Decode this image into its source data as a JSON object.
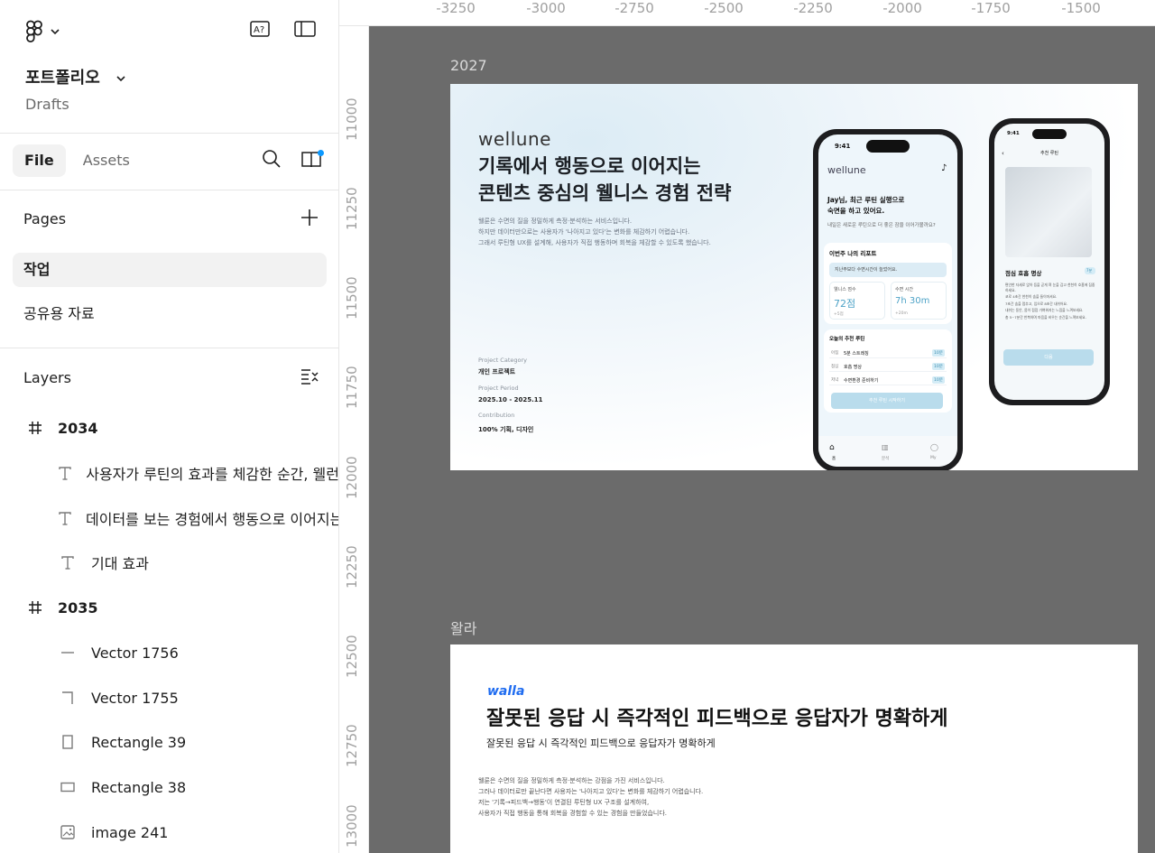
{
  "header": {
    "project_name": "포트폴리오",
    "project_location": "Drafts"
  },
  "tabs": {
    "file": "File",
    "assets": "Assets"
  },
  "pages": {
    "title": "Pages",
    "items": [
      "작업",
      "공유용 자료"
    ]
  },
  "layers": {
    "title": "Layers",
    "items": [
      {
        "kind": "frame",
        "icon": "frame-icon",
        "label": "2034"
      },
      {
        "kind": "text",
        "icon": "text-icon",
        "label": "사용자가 루틴의 효과를 체감한 순간, 웰런"
      },
      {
        "kind": "text",
        "icon": "text-icon",
        "label": "데이터를 보는 경험에서 행동으로 이어지는"
      },
      {
        "kind": "text",
        "icon": "text-icon",
        "label": "기대 효과"
      },
      {
        "kind": "frame",
        "icon": "frame-icon",
        "label": "2035"
      },
      {
        "kind": "vector",
        "icon": "line-icon",
        "label": "Vector 1756"
      },
      {
        "kind": "vector",
        "icon": "corner-icon",
        "label": "Vector 1755"
      },
      {
        "kind": "rect",
        "icon": "rectangle-portrait-icon",
        "label": "Rectangle 39"
      },
      {
        "kind": "rect",
        "icon": "rectangle-landscape-icon",
        "label": "Rectangle 38"
      },
      {
        "kind": "image",
        "icon": "image-icon",
        "label": "image 241"
      }
    ]
  },
  "ruler": {
    "top": [
      "-3250",
      "-3000",
      "-2750",
      "-2500",
      "-2250",
      "-2000",
      "-1750",
      "-1500"
    ],
    "left": [
      "11000",
      "11250",
      "11500",
      "11750",
      "12000",
      "12250",
      "12500",
      "12750",
      "13000"
    ]
  },
  "canvas": {
    "frame1": {
      "label": "2027",
      "brand": "wellune",
      "headline1": "기록에서 행동으로 이어지는",
      "headline2": "콘텐츠 중심의 웰니스 경험 전략",
      "desc1": "웰룬은 수면의 질을 정밀하게 측정·분석하는 서비스입니다.",
      "desc2": "하지만 데이터만으로는 사용자가 '나아지고 있다'는 변화를 체감하기 어렵습니다.",
      "desc3": "그래서 루틴형 UX를 설계해, 사용자가 직접 행동하며 회복을 체감할 수 있도록 했습니다.",
      "meta_category_label": "Project Category",
      "meta_category": "개인 프로젝트",
      "meta_period_label": "Project Period",
      "meta_period": "2025.10 - 2025.11",
      "meta_contrib_label": "Contribution",
      "meta_contrib": "100% 기획, 디자인",
      "phone1": {
        "time": "9:41",
        "brand": "wellune",
        "greeting1": "Jay님, 최근 루틴 실행으로",
        "greeting2": "숙면을 하고 있어요.",
        "question": "내일은 새로운 루틴으로 더 좋은 잠을 이어가볼까요?",
        "report_title": "이번주 나의 리포트",
        "report_note": "지난주보다 수면시간이 늘었어요.",
        "score_label": "웰니스 점수",
        "score_value": "72점",
        "score_delta": "+5점",
        "sleep_label": "수면 시간",
        "sleep_value": "7h 30m",
        "sleep_delta": "+20m",
        "routine_title": "오늘의 추천 루틴",
        "routines": [
          {
            "tag": "아침",
            "name": "5분 스트레칭",
            "time": "10분"
          },
          {
            "tag": "점심",
            "name": "호흡 명상",
            "time": "10분"
          },
          {
            "tag": "저녁",
            "name": "수면환경 준비하기",
            "time": "10분"
          }
        ],
        "cta": "추천 루틴 시작하기",
        "nav": [
          "홈",
          "분석",
          "My"
        ]
      },
      "phone2": {
        "time": "9:41",
        "title": "추천 루틴",
        "routine_name": "점심 호흡 명상",
        "badge": "7분",
        "bullets": [
          "편안한 자세로 앉아 등을 곧게 펴 눈을 감고 천천히 호흡에 집중하세요.",
          "코로 4초간 천천히 숨을 들이마셔요.",
          "7초간 숨을 멈추고, 입으로 8초간 내쉬어요.",
          "내쉬는 동안, 몸이 점점 가벼워지는 느낌을 느껴보세요.",
          "총 5~7분간 반복하며 마음을 비우는 순간을 느껴보세요."
        ],
        "cta": "다음"
      }
    },
    "frame2": {
      "label": "왈라",
      "brand": "walla",
      "headline": "잘못된 응답 시 즉각적인 피드백으로 응답자가 명확하게",
      "subheadline": "잘못된 응답 시 즉각적인 피드백으로 응답자가 명확하게",
      "desc1": "웰룬은 수면의 질을 정밀하게 측정·분석하는 강점을 가진 서비스입니다.",
      "desc2": "그러나 데이터로만 끝난다면 사용자는 '나아지고 있다'는 변화를 체감하기 어렵습니다.",
      "desc3": "저는 '기록→피드백→행동'이 연결된 루틴형 UX 구조를 설계하여,",
      "desc4": "사용자가 직접 행동을 통해 회복을 경험할 수 있는 경험을 만들었습니다."
    }
  }
}
